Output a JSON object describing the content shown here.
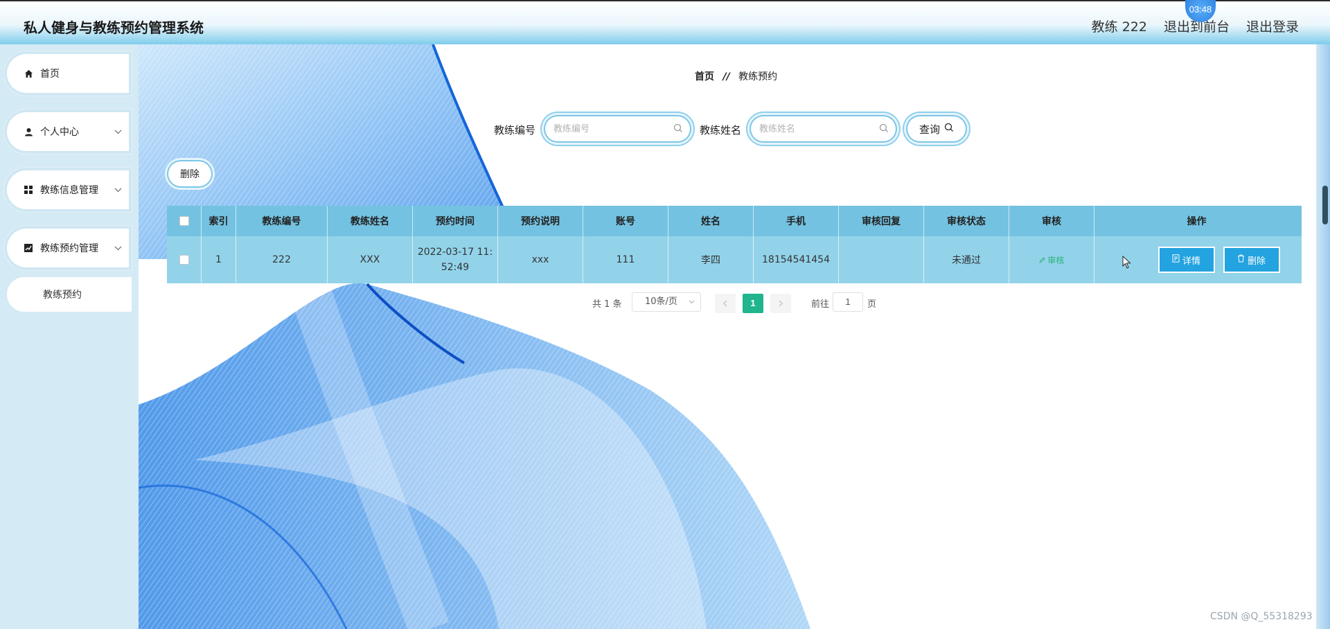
{
  "header": {
    "title": "私人健身与教练预约管理系统",
    "user": "教练 222",
    "front_link": "退出到前台",
    "logout": "退出登录",
    "timer": "03:48"
  },
  "sidebar": {
    "items": [
      {
        "label": "首页",
        "icon": "home-icon"
      },
      {
        "label": "个人中心",
        "icon": "user-icon"
      },
      {
        "label": "教练信息管理",
        "icon": "grid-icon"
      },
      {
        "label": "教练预约管理",
        "icon": "chart-icon"
      }
    ],
    "subitems": [
      {
        "label": "教练预约"
      }
    ]
  },
  "breadcrumb": {
    "home": "首页",
    "separator": "//",
    "current": "教练预约"
  },
  "search": {
    "coach_no_label": "教练编号",
    "coach_no_placeholder": "教练编号",
    "coach_name_label": "教练姓名",
    "coach_name_placeholder": "教练姓名",
    "query_label": "查询"
  },
  "toolbar": {
    "delete_label": "删除"
  },
  "table": {
    "headers": [
      "索引",
      "教练编号",
      "教练姓名",
      "预约时间",
      "预约说明",
      "账号",
      "姓名",
      "手机",
      "审核回复",
      "审核状态",
      "审核",
      "操作"
    ],
    "rows": [
      {
        "index": "1",
        "coach_no": "222",
        "coach_name": "XXX",
        "time_line1": "2022-03-17 11:",
        "time_line2": "52:49",
        "note": "xxx",
        "account": "111",
        "name": "李四",
        "phone": "18154541454",
        "reply": "",
        "status": "未通过",
        "audit": "审核",
        "detail_label": "详情",
        "delete_label": "删除"
      }
    ]
  },
  "pagination": {
    "total": "共 1 条",
    "page_size": "10条/页",
    "current": "1",
    "goto_prefix": "前往",
    "goto_value": "1",
    "goto_suffix": "页"
  },
  "watermark": "CSDN @Q_55318293",
  "colors": {
    "header_accent": "#7fcdec",
    "table_header": "#74c2e1",
    "table_row": "#92d3ea",
    "action_button": "#23a3df",
    "current_page": "#20b58c",
    "audit_link": "#2db07a"
  }
}
